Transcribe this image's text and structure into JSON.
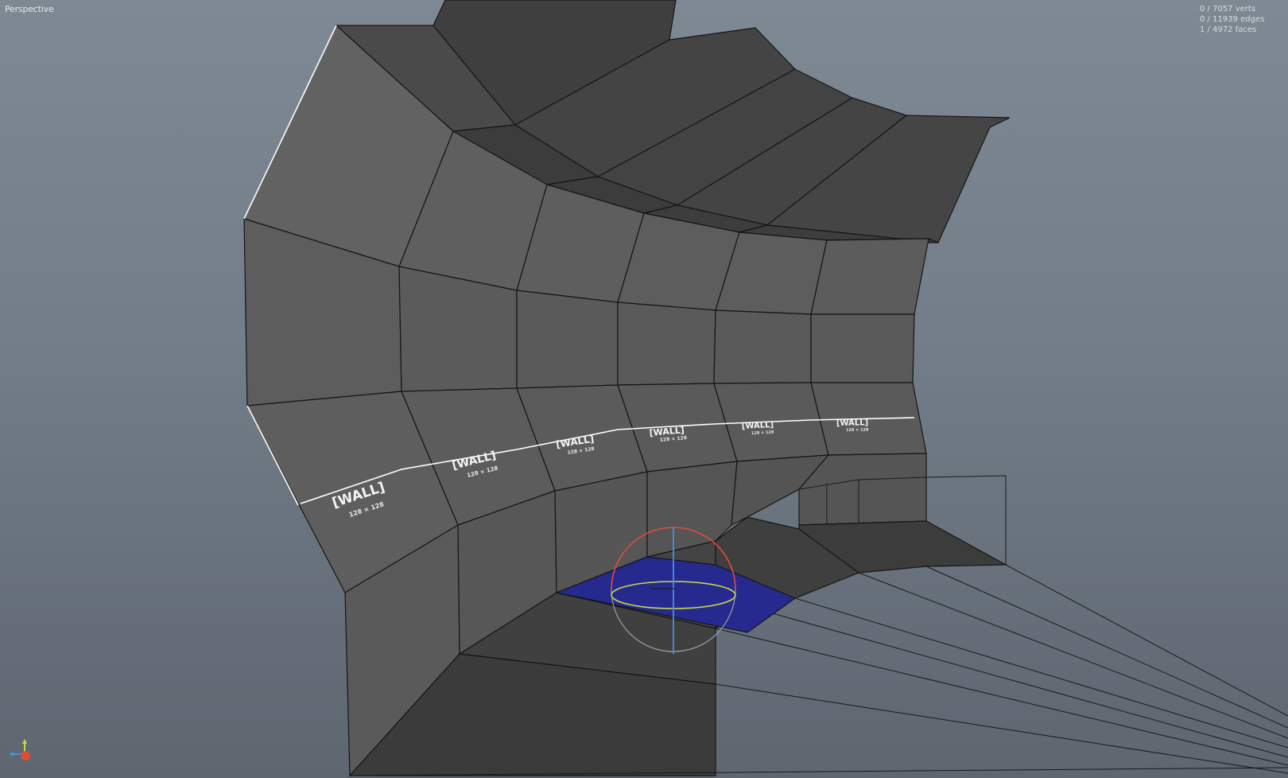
{
  "viewport": {
    "view_name": "Perspective"
  },
  "stats": {
    "verts": "0 / 7057 verts",
    "edges": "0 / 11939 edges",
    "faces": "1 / 4972 faces"
  },
  "textures": {
    "wall_label": "[WALL]",
    "wall_size": "128 × 128"
  },
  "colors": {
    "background_top": "#7e8993",
    "background_bottom": "#5e6670",
    "wall_face": "#5d5d5d",
    "ceiling_face": "#454545",
    "floor_face": "#3e3e3e",
    "selected_face": "#252a8c",
    "edge": "#111111",
    "gizmo_x": "#e04a3a",
    "gizmo_y": "#c8d84a",
    "gizmo_z": "#4a8fe0"
  },
  "icons": {
    "axis": "axis-gizmo-icon",
    "manipulator": "rotate-manipulator-icon"
  }
}
